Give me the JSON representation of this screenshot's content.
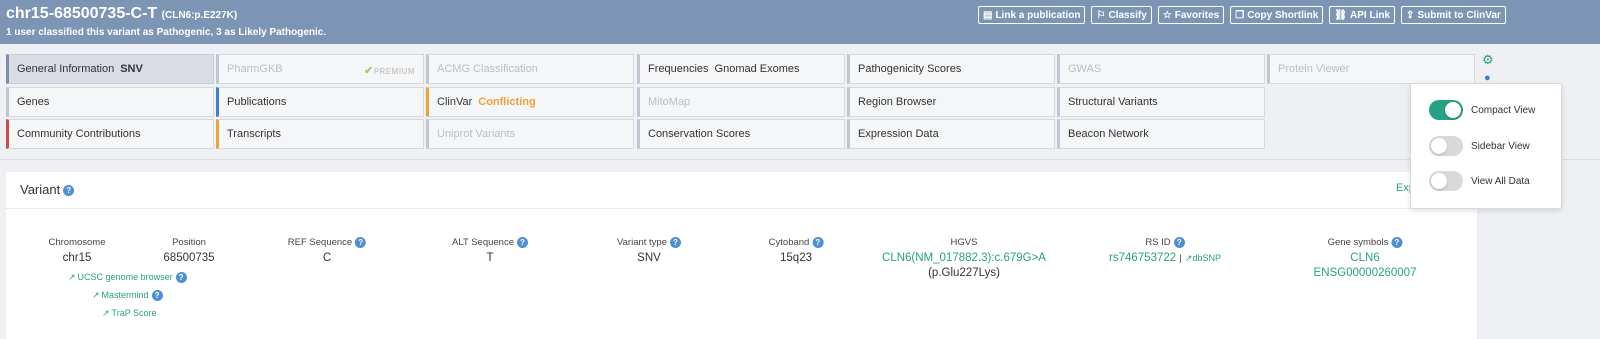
{
  "header": {
    "title": "chr15-68500735-C-T",
    "title_sub": "(CLN6:p.E227K)",
    "subtitle": "1 user classified this variant as Pathogenic, 3 as Likely Pathogenic.",
    "buttons": [
      {
        "icon": "document-icon",
        "glyph": "▤",
        "label": "Link a publication"
      },
      {
        "icon": "flag-icon",
        "glyph": "⚐",
        "label": "Classify"
      },
      {
        "icon": "star-icon",
        "glyph": "☆",
        "label": "Favorites"
      },
      {
        "icon": "copy-icon",
        "glyph": "❐",
        "label": "Copy Shortlink"
      },
      {
        "icon": "link-icon",
        "glyph": "⛓",
        "label": "API Link"
      },
      {
        "icon": "upload-icon",
        "glyph": "⇪",
        "label": "Submit to ClinVar"
      }
    ]
  },
  "nav": {
    "general": {
      "label": "General Information",
      "value": "SNV"
    },
    "pharmgkb": {
      "label": "PharmGKB",
      "badge": "PREMIUM"
    },
    "acmg": {
      "label": "ACMG Classification"
    },
    "frequencies": {
      "label": "Frequencies",
      "value": "Gnomad Exomes"
    },
    "pathogenicity": {
      "label": "Pathogenicity Scores"
    },
    "gwas": {
      "label": "GWAS"
    },
    "protein_viewer": {
      "label": "Protein Viewer"
    },
    "genes": {
      "label": "Genes"
    },
    "publications": {
      "label": "Publications"
    },
    "clinvar": {
      "label": "ClinVar",
      "value": "Conflicting"
    },
    "mitomap": {
      "label": "MitoMap"
    },
    "region_browser": {
      "label": "Region Browser"
    },
    "structural_variants": {
      "label": "Structural Variants"
    },
    "community": {
      "label": "Community Contributions"
    },
    "transcripts": {
      "label": "Transcripts"
    },
    "uniprot": {
      "label": "Uniprot Variants"
    },
    "conservation": {
      "label": "Conservation Scores"
    },
    "expression": {
      "label": "Expression Data"
    },
    "beacon": {
      "label": "Beacon Network"
    }
  },
  "view_options": {
    "compact": {
      "label": "Compact View",
      "on": true
    },
    "sidebar": {
      "label": "Sidebar View",
      "on": false
    },
    "all_data": {
      "label": "View All Data",
      "on": false
    }
  },
  "variant": {
    "title": "Variant",
    "expand_label": "Exp",
    "chromosome": {
      "label": "Chromosome",
      "value": "chr15"
    },
    "position": {
      "label": "Position",
      "value": "68500735"
    },
    "ref": {
      "label": "REF Sequence",
      "value": "C"
    },
    "alt": {
      "label": "ALT Sequence",
      "value": "T"
    },
    "variant_type": {
      "label": "Variant type",
      "value": "SNV"
    },
    "cytoband": {
      "label": "Cytoband",
      "value": "15q23"
    },
    "hgvs": {
      "label": "HGVS",
      "value": "CLN6(NM_017882.3):c.679G>A",
      "protein": "(p.Glu227Lys)"
    },
    "rsid": {
      "label": "RS ID",
      "value": "rs746753722",
      "separator": "|",
      "dbsnp": "dbSNP"
    },
    "gene_symbols": {
      "label": "Gene symbols",
      "symbol": "CLN6",
      "ensembl": "ENSG00000260007"
    },
    "links": {
      "ucsc": "UCSC genome browser",
      "mastermind": "Mastermind",
      "trap": "TraP Score"
    }
  },
  "colors": {
    "header_bg": "#7c95b4",
    "accent_green": "#26a184",
    "orange": "#f0a23a",
    "blue_border": "#3f7ecf",
    "red_border": "#d04a4a",
    "orange_border": "#f0a23a"
  }
}
